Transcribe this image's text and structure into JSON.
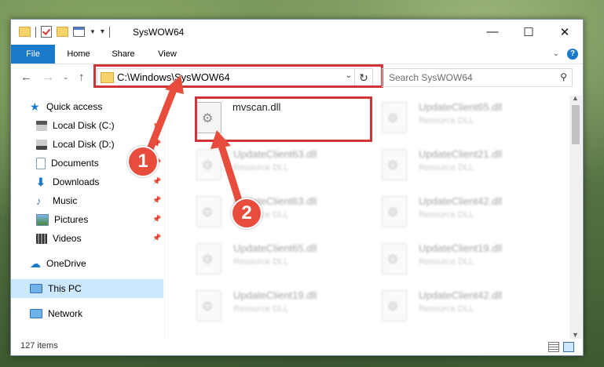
{
  "window": {
    "title": "SysWOW64"
  },
  "window_controls": {
    "minimize": "—",
    "maximize": "☐",
    "close": "✕"
  },
  "ribbon": {
    "tabs": [
      "File",
      "Home",
      "Share",
      "View"
    ],
    "help": "?"
  },
  "navigation": {
    "address": "C:\\Windows\\SysWOW64",
    "search_placeholder": "Search SysWOW64"
  },
  "sidebar": {
    "items": [
      {
        "label": "Quick access"
      },
      {
        "label": "Local Disk (C:)"
      },
      {
        "label": "Local Disk (D:)"
      },
      {
        "label": "Documents"
      },
      {
        "label": "Downloads"
      },
      {
        "label": "Music"
      },
      {
        "label": "Pictures"
      },
      {
        "label": "Videos"
      },
      {
        "label": "OneDrive"
      },
      {
        "label": "This PC"
      },
      {
        "label": "Network"
      }
    ]
  },
  "files": {
    "highlighted": {
      "name": "mvscan.dll"
    },
    "faded": [
      {
        "name": "UpdateClient65.dll",
        "type": "Resource DLL"
      },
      {
        "name": "UpdateClient63.dll",
        "type": "Resource DLL"
      },
      {
        "name": "UpdateClient21.dll",
        "type": "Resource DLL"
      },
      {
        "name": "UpdateClient63.dll",
        "type": "Resource DLL"
      },
      {
        "name": "UpdateClient42.dll",
        "type": "Resource DLL"
      },
      {
        "name": "UpdateClient65.dll",
        "type": "Resource DLL"
      },
      {
        "name": "UpdateClient19.dll",
        "type": "Resource DLL"
      },
      {
        "name": "UpdateClient19.dll",
        "type": "Resource DLL"
      },
      {
        "name": "UpdateClient42.dll",
        "type": "Resource DLL"
      }
    ]
  },
  "status": {
    "item_count": "127 items"
  },
  "markers": [
    "1",
    "2"
  ],
  "colors": {
    "accent": "#1979ca",
    "highlight": "#d03436",
    "marker": "#e74c3c",
    "selected": "#cce8ff"
  }
}
